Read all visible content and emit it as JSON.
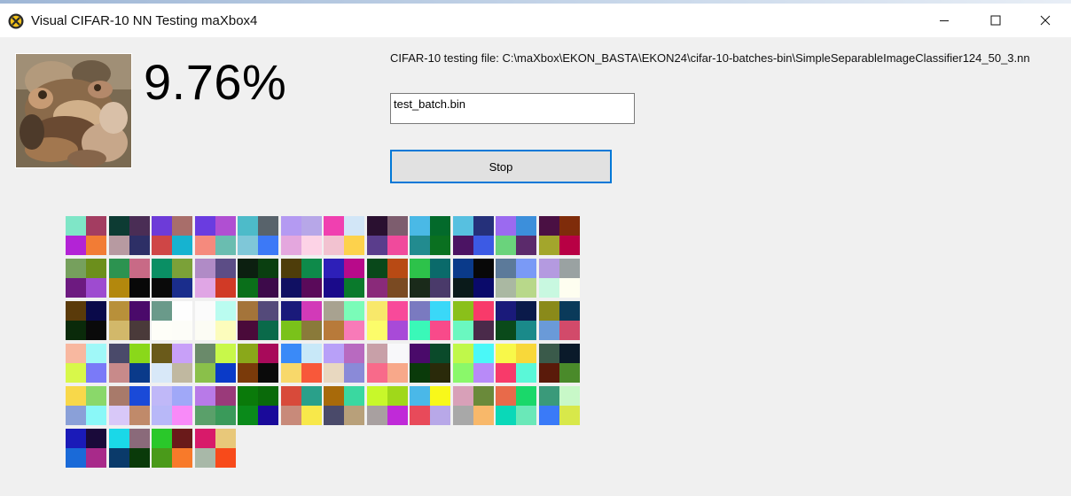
{
  "window": {
    "title": "Visual CIFAR-10 NN Testing maXbox4",
    "icon": "maxbox-x-icon",
    "controls": [
      "minimize-icon",
      "maximize-icon",
      "close-icon"
    ]
  },
  "result": {
    "accuracy_text": "9.76%"
  },
  "test_file": {
    "label": "CIFAR-10 testing file: C:\\maXbox\\EKON_BASTA\\EKON24\\cifar-10-batches-bin\\SimpleSeparableImageClassifier124_50_3.nn"
  },
  "batch_input": {
    "value": "test_batch.bin"
  },
  "stop_button": {
    "label": "Stop"
  },
  "colors": {
    "accent": "#0078d7",
    "background": "#f0f0f0",
    "button": "#e1e1e1"
  },
  "filter_tiles": [
    [
      "#7fe6c7",
      "#a33d61",
      "#b323d6",
      "#f27c35"
    ],
    [
      "#0d3b33",
      "#4a2d55",
      "#b79aa1",
      "#2d2f66"
    ],
    [
      "#6d3bd8",
      "#a86e6a",
      "#cf4646",
      "#16b3d0"
    ],
    [
      "#6a3ce0",
      "#b04fd2",
      "#f58a7d",
      "#6abdb0"
    ],
    [
      "#4dbbc9",
      "#58636b",
      "#7fc7d8",
      "#3c79f7"
    ],
    [
      "#b49af2",
      "#b7a7e8",
      "#e4a7de",
      "#fdd3e6"
    ],
    [
      "#f040b0",
      "#d2e6f7",
      "#f2c2d0",
      "#fdd24c"
    ],
    [
      "#2a1030",
      "#7d5d6e",
      "#5a3d8c",
      "#f04a9c"
    ],
    [
      "#4ab9e6",
      "#036a2b",
      "#228b8f",
      "#0a7020"
    ],
    [
      "#57c0e0",
      "#25307a",
      "#4b1363",
      "#3c5ae4"
    ],
    [
      "#9b6af0",
      "#3c8fdb",
      "#6ad37c",
      "#5b2a6b"
    ],
    [
      "#4a1043",
      "#7f2c0a",
      "#a3a62c",
      "#b80044"
    ],
    [
      "#76a05d",
      "#6c8f1c",
      "#6d1a80",
      "#9e4bd0"
    ],
    [
      "#2c9350",
      "#c86a86",
      "#b3880d",
      "#080808"
    ],
    [
      "#0a8f64",
      "#7ba138",
      "#0a0a0a",
      "#1a2d8c"
    ],
    [
      "#b08bc6",
      "#5c4d86",
      "#e0a6e5",
      "#d13a26"
    ],
    [
      "#0c1f10",
      "#0a3f10",
      "#0a6f1a",
      "#3d0a4a"
    ],
    [
      "#4e3d0a",
      "#0e8a4a",
      "#101062",
      "#5a0a5a"
    ],
    [
      "#2d1fb8",
      "#b80a8a",
      "#1a0a8a",
      "#0a7a2c"
    ],
    [
      "#09481a",
      "#b84a14",
      "#8a2a7a",
      "#7a4a22"
    ],
    [
      "#2dc24a",
      "#0a6a6a",
      "#1a2a1a",
      "#4a3a6a"
    ],
    [
      "#0a3a8a",
      "#080808",
      "#0a1a1a",
      "#0a0a6a"
    ],
    [
      "#5c7a9a",
      "#7a9af6",
      "#aab8a2",
      "#b8d88a"
    ],
    [
      "#b49ae0",
      "#9aa2a2",
      "#c8f8e0",
      "#fefef0"
    ],
    [
      "#5a3a0a",
      "#0a0a4a",
      "#0a2a0a",
      "#0a0a0a"
    ],
    [
      "#b8903a",
      "#4a0a6a",
      "#d2b86a",
      "#4a3a3a"
    ],
    [
      "#6a9a8a",
      "#fefefe",
      "#fefef8",
      "#fdfdf8"
    ],
    [
      "#fbfbfb",
      "#bafcf0",
      "#fcfcf4",
      "#fcfcbc"
    ],
    [
      "#a4743a",
      "#544a7a",
      "#4a0a3a",
      "#0a6a4a"
    ],
    [
      "#1a1a7a",
      "#d23ab8",
      "#7ac21a",
      "#8a7a3a"
    ],
    [
      "#a8a290",
      "#7afcb8",
      "#b87a3a",
      "#f87ab8"
    ],
    [
      "#f8e86a",
      "#f84a9a",
      "#fcfc6a",
      "#a84ad8"
    ],
    [
      "#7a7ac0",
      "#3ad8f8",
      "#3af8b8",
      "#f84a8a"
    ],
    [
      "#8ac01a",
      "#f83a6a",
      "#6af8c0",
      "#4a2a4a"
    ],
    [
      "#1a1a7a",
      "#0a1a4a",
      "#0a4a1a",
      "#1a8a8a"
    ],
    [
      "#8a8a1a",
      "#0a3a5a",
      "#6a9ad8",
      "#d24a6a"
    ],
    [
      "#f8b8a0",
      "#a0f8f8",
      "#d8f84a",
      "#7a7af8"
    ],
    [
      "#4a4a6a",
      "#8ad81a",
      "#c88a8a",
      "#0a3a8a"
    ],
    [
      "#6a5a1a",
      "#c8a0f8",
      "#d8e8f8",
      "#c0b8a0"
    ],
    [
      "#6a8a6a",
      "#c8f84a",
      "#8ac04a",
      "#0a3ac8"
    ],
    [
      "#8aa81a",
      "#a80a5a",
      "#7a3a0a",
      "#0a0a0a"
    ],
    [
      "#3a8af8",
      "#c8e8f8",
      "#f8d86a",
      "#f8583a"
    ],
    [
      "#b8a0f8",
      "#b86ac0",
      "#e8d8c0",
      "#8a8ad8"
    ],
    [
      "#c8a0a8",
      "#f8f8fa",
      "#f86a8a",
      "#f8a88a"
    ],
    [
      "#4a0a6a",
      "#0a4a2a",
      "#0a3a0a",
      "#2a2a0a"
    ],
    [
      "#c0f84a",
      "#4af8f8",
      "#8af86a",
      "#b88af8"
    ],
    [
      "#f8f84a",
      "#f8d83a",
      "#f83a6a",
      "#5af8d8"
    ],
    [
      "#3a5a4a",
      "#0a1a2a",
      "#5a1a0a",
      "#4a8a2a"
    ],
    [
      "#f8d84a",
      "#8ad86a",
      "#8aa0d8",
      "#8af8f8"
    ],
    [
      "#a87a6a",
      "#1a4ad8",
      "#d8c8f8",
      "#c08a6a"
    ],
    [
      "#c0b8f8",
      "#a0a8f8",
      "#b8b8f8",
      "#f88af8"
    ],
    [
      "#b87ae8",
      "#9a3a7a",
      "#5aa06a",
      "#3a9a5a"
    ],
    [
      "#0a7a0a",
      "#0a6a0a",
      "#0a8a1a",
      "#1a0a9a"
    ],
    [
      "#d84a3a",
      "#2aa08a",
      "#c88a7a",
      "#f8e84a"
    ],
    [
      "#a86a0a",
      "#3ad8a0",
      "#4a4a6a",
      "#b8a07a"
    ],
    [
      "#c8f82a",
      "#a0d81a",
      "#a8a0a0",
      "#c02ad8"
    ],
    [
      "#4ab8e8",
      "#f8f81a",
      "#e84a5a",
      "#b8a8e8"
    ],
    [
      "#d8a0b8",
      "#6a8a3a",
      "#a8a8a8",
      "#f8b86a"
    ],
    [
      "#e86a4a",
      "#1ad86a",
      "#0ad8b8",
      "#6ae8b8"
    ],
    [
      "#3a9a7a",
      "#c8f8c8",
      "#3a7af8",
      "#d8e84a"
    ],
    [
      "#1a1ab8",
      "#1a0a3a",
      "#1a6ad8",
      "#a82a8a"
    ],
    [
      "#1ad8e8",
      "#8a6a7a",
      "#0a3a6a",
      "#0a3a0a"
    ],
    [
      "#2ac82a",
      "#6a1a1a",
      "#4a9a1a",
      "#f87a2a"
    ],
    [
      "#d81a6a",
      "#e8c87a",
      "#a8b8a8",
      "#f84a1a"
    ]
  ]
}
